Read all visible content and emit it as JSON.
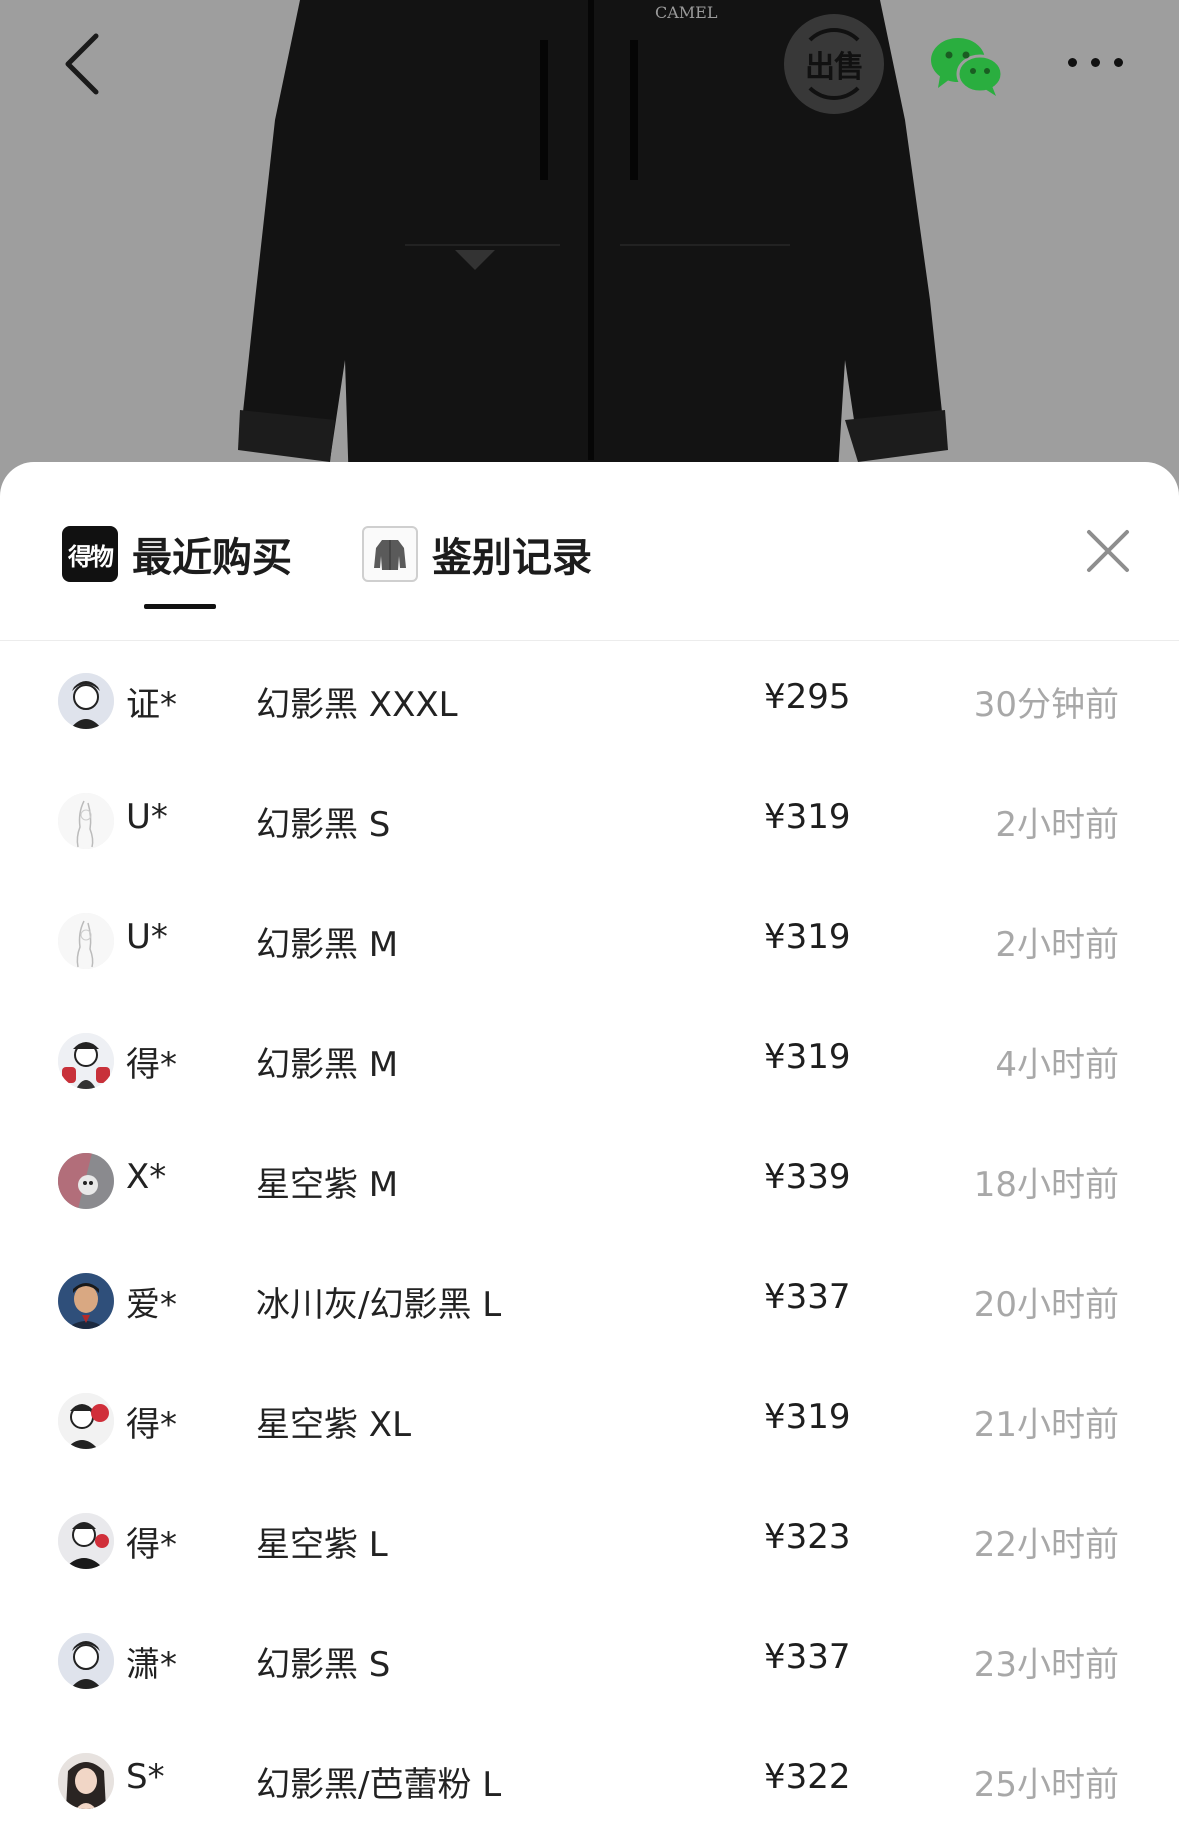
{
  "header": {
    "brand_text": "CAMEL",
    "sell_label": "出售"
  },
  "tabs": [
    {
      "logo_text": "得物",
      "label": "最近购买"
    },
    {
      "label": "鉴别记录"
    }
  ],
  "purchases": [
    {
      "user": "证*",
      "spec": "幻影黑 XXXL",
      "price": "¥295",
      "time": "30分钟前"
    },
    {
      "user": "U*",
      "spec": "幻影黑 S",
      "price": "¥319",
      "time": "2小时前"
    },
    {
      "user": "U*",
      "spec": "幻影黑 M",
      "price": "¥319",
      "time": "2小时前"
    },
    {
      "user": "得*",
      "spec": "幻影黑 M",
      "price": "¥319",
      "time": "4小时前"
    },
    {
      "user": "X*",
      "spec": "星空紫 M",
      "price": "¥339",
      "time": "18小时前"
    },
    {
      "user": "爱*",
      "spec": "冰川灰/幻影黑 L",
      "price": "¥337",
      "time": "20小时前"
    },
    {
      "user": "得*",
      "spec": "星空紫 XL",
      "price": "¥319",
      "time": "21小时前"
    },
    {
      "user": "得*",
      "spec": "星空紫 L",
      "price": "¥323",
      "time": "22小时前"
    },
    {
      "user": "潇*",
      "spec": "幻影黑 S",
      "price": "¥337",
      "time": "23小时前"
    },
    {
      "user": "S*",
      "spec": "幻影黑/芭蕾粉 L",
      "price": "¥322",
      "time": "25小时前"
    }
  ],
  "colors": {
    "sheet_bg": "#ffffff",
    "text_primary": "#222222",
    "text_secondary": "#a8a8a8",
    "wechat_green": "#2aae3f"
  },
  "icons": [
    "back-icon",
    "sell-icon",
    "wechat-icon",
    "more-icon",
    "close-icon"
  ]
}
